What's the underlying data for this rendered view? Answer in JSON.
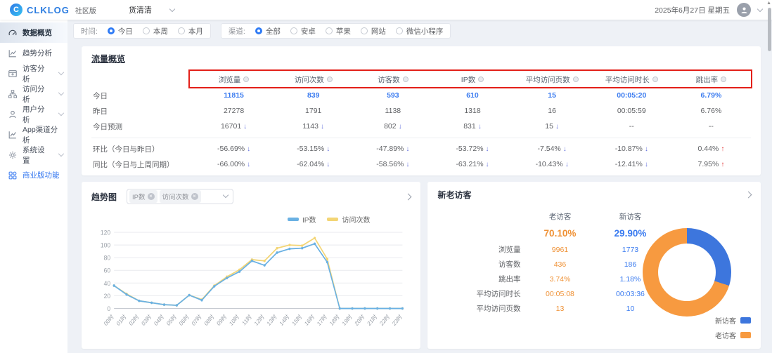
{
  "header": {
    "logo_text": "CLKLOG",
    "edition_badge": "社区版",
    "project_name": "货清清",
    "date_text": "2025年6月27日 星期五"
  },
  "sidebar": {
    "items": [
      {
        "label": "数据概览"
      },
      {
        "label": "趋势分析"
      },
      {
        "label": "访客分析"
      },
      {
        "label": "访问分析"
      },
      {
        "label": "用户分析"
      },
      {
        "label": "App渠道分析"
      },
      {
        "label": "系统设置"
      },
      {
        "label": "商业版功能"
      }
    ]
  },
  "filters": {
    "time_label": "时间:",
    "time_options": [
      "今日",
      "本周",
      "本月"
    ],
    "time_selected": "今日",
    "channel_label": "渠道:",
    "channel_options": [
      "全部",
      "安卓",
      "苹果",
      "网站",
      "微信小程序"
    ],
    "channel_selected": "全部"
  },
  "traffic_overview": {
    "title": "流量概览",
    "columns": [
      "浏览量",
      "访问次数",
      "访客数",
      "IP数",
      "平均访问页数",
      "平均访问时长",
      "跳出率"
    ],
    "rows": [
      {
        "label": "今日",
        "cells": [
          {
            "v": "11815"
          },
          {
            "v": "839"
          },
          {
            "v": "593"
          },
          {
            "v": "610"
          },
          {
            "v": "15"
          },
          {
            "v": "00:05:20"
          },
          {
            "v": "6.79%"
          }
        ]
      },
      {
        "label": "昨日",
        "cells": [
          {
            "v": "27278"
          },
          {
            "v": "1791"
          },
          {
            "v": "1138"
          },
          {
            "v": "1318"
          },
          {
            "v": "16"
          },
          {
            "v": "00:05:59"
          },
          {
            "v": "6.76%"
          }
        ]
      },
      {
        "label": "今日预测",
        "cells": [
          {
            "v": "16701",
            "a": "↓"
          },
          {
            "v": "1143",
            "a": "↓"
          },
          {
            "v": "802",
            "a": "↓"
          },
          {
            "v": "831",
            "a": "↓"
          },
          {
            "v": "15",
            "a": "↓"
          },
          {
            "v": "--"
          },
          {
            "v": "--"
          }
        ]
      },
      {
        "label": "环比（今日与昨日）",
        "cells": [
          {
            "v": "-56.69%",
            "a": "↓"
          },
          {
            "v": "-53.15%",
            "a": "↓"
          },
          {
            "v": "-47.89%",
            "a": "↓"
          },
          {
            "v": "-53.72%",
            "a": "↓"
          },
          {
            "v": "-7.54%",
            "a": "↓"
          },
          {
            "v": "-10.87%",
            "a": "↓"
          },
          {
            "v": "0.44%",
            "a": "↑"
          }
        ]
      },
      {
        "label": "同比（今日与上周同期）",
        "cells": [
          {
            "v": "-66.00%",
            "a": "↓"
          },
          {
            "v": "-62.04%",
            "a": "↓"
          },
          {
            "v": "-58.56%",
            "a": "↓"
          },
          {
            "v": "-63.21%",
            "a": "↓"
          },
          {
            "v": "-10.43%",
            "a": "↓"
          },
          {
            "v": "-12.41%",
            "a": "↓"
          },
          {
            "v": "7.95%",
            "a": "↑"
          }
        ]
      }
    ]
  },
  "trend": {
    "title": "趋势图",
    "selected_metrics": [
      "IP数",
      "访问次数"
    ],
    "legend": [
      "IP数",
      "访问次数"
    ]
  },
  "visitors": {
    "title": "新老访客",
    "col_old": "老访客",
    "col_new": "新访客",
    "old_pct": "70.10%",
    "new_pct": "29.90%",
    "rows": [
      {
        "label": "浏览量",
        "old": "9961",
        "new": "1773"
      },
      {
        "label": "访客数",
        "old": "436",
        "new": "186"
      },
      {
        "label": "跳出率",
        "old": "3.74%",
        "new": "1.18%"
      },
      {
        "label": "平均访问时长",
        "old": "00:05:08",
        "new": "00:03:36"
      },
      {
        "label": "平均访问页数",
        "old": "13",
        "new": "10"
      }
    ],
    "legend": [
      "新访客",
      "老访客"
    ]
  },
  "chart_data": [
    {
      "type": "line",
      "title": "趋势图",
      "x": [
        "00时",
        "01时",
        "02时",
        "03时",
        "04时",
        "05时",
        "06时",
        "07时",
        "08时",
        "09时",
        "10时",
        "11时",
        "12时",
        "13时",
        "14时",
        "15时",
        "16时",
        "17时",
        "18时",
        "19时",
        "20时",
        "21时",
        "22时",
        "23时"
      ],
      "series": [
        {
          "name": "IP数",
          "color": "#6ab1e3",
          "values": [
            36,
            22,
            12,
            9,
            6,
            5,
            21,
            13,
            35,
            48,
            58,
            75,
            68,
            88,
            94,
            95,
            102,
            73,
            0,
            0,
            0,
            0,
            0,
            0
          ]
        },
        {
          "name": "访问次数",
          "color": "#f3d575",
          "values": [
            36,
            23,
            12,
            9,
            6,
            5,
            21,
            14,
            36,
            50,
            61,
            77,
            75,
            95,
            100,
            99,
            111,
            78,
            0,
            0,
            0,
            0,
            0,
            0
          ]
        }
      ],
      "xlabel": "",
      "ylabel": "",
      "ylim": [
        0,
        120
      ],
      "y_ticks": [
        0,
        20,
        40,
        60,
        80,
        100,
        120
      ],
      "grid": true,
      "legend": [
        "IP数",
        "访问次数"
      ],
      "legend_position": "top-right"
    },
    {
      "type": "pie",
      "donut": true,
      "title": "新老访客",
      "labels": [
        "新访客",
        "老访客"
      ],
      "values": [
        29.9,
        70.1
      ],
      "colors": [
        "#3d76dd",
        "#f79a40"
      ],
      "legend_position": "bottom-right"
    }
  ],
  "colors": {
    "accent_blue": "#3a7bf0",
    "metric_blue": "#3a7bf0",
    "old_visitor_orange": "#ef9135",
    "down_arrow": "#6673dd",
    "up_arrow": "#e23a3a",
    "annotation_red": "#e32019"
  }
}
